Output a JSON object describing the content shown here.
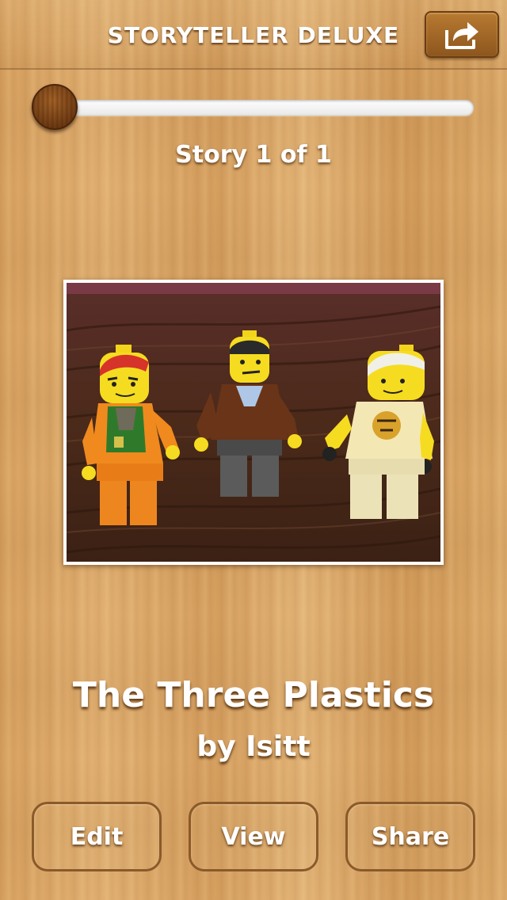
{
  "nav": {
    "title": "STORYTELLER DELUXE",
    "share_icon": "share-icon"
  },
  "slider": {
    "position": 0
  },
  "story": {
    "count_label": "Story 1 of 1",
    "title": "The Three Plastics",
    "author": "by Isitt",
    "photo_description": "three toy minifigures on wooden table"
  },
  "actions": {
    "edit_label": "Edit",
    "view_label": "View",
    "share_label": "Share"
  },
  "colors": {
    "wood_light": "#e2b173",
    "wood_dark": "#b87a32",
    "text": "#ffffff",
    "button_border": "#8a5a2a"
  }
}
